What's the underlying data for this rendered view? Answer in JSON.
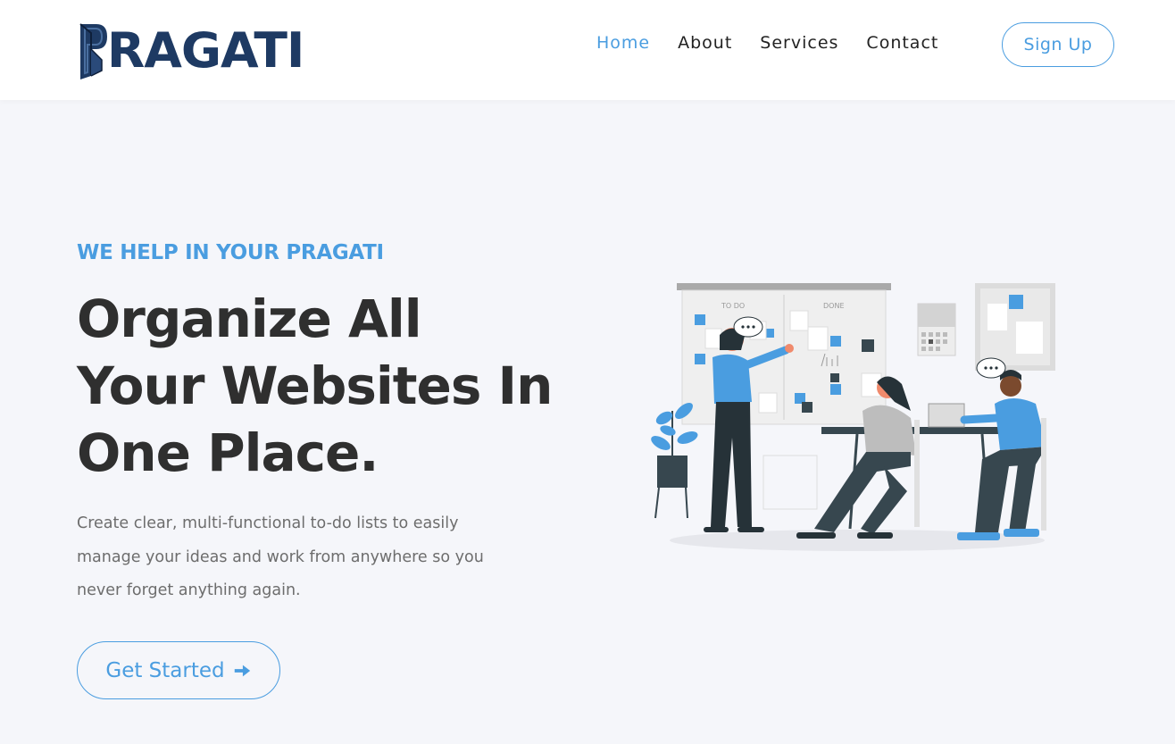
{
  "brand": {
    "name": "RAGATI",
    "logo_icon": "pragati-p-logo-icon"
  },
  "nav": {
    "items": [
      {
        "label": "Home",
        "active": true
      },
      {
        "label": "About",
        "active": false
      },
      {
        "label": "Services",
        "active": false
      },
      {
        "label": "Contact",
        "active": false
      }
    ],
    "signup_label": "Sign Up"
  },
  "hero": {
    "eyebrow": "WE HELP IN YOUR PRAGATI",
    "headline_line1": "Organize All",
    "headline_line2": "Your Websites In",
    "headline_line3": "One Place.",
    "description": "Create clear, multi-functional to-do lists to easily manage your ideas and work from anywhere so you never forget anything again.",
    "cta_label": "Get Started",
    "cta_icon": "arrow-right-icon"
  },
  "illustration": {
    "board_col1": "TO DO",
    "board_col2": "DONE"
  },
  "colors": {
    "accent": "#4a9de0",
    "brand_dark": "#1e3a63",
    "heading": "#2f2f2f",
    "body_text": "#6d6d6d",
    "background": "#f5f6fa"
  }
}
